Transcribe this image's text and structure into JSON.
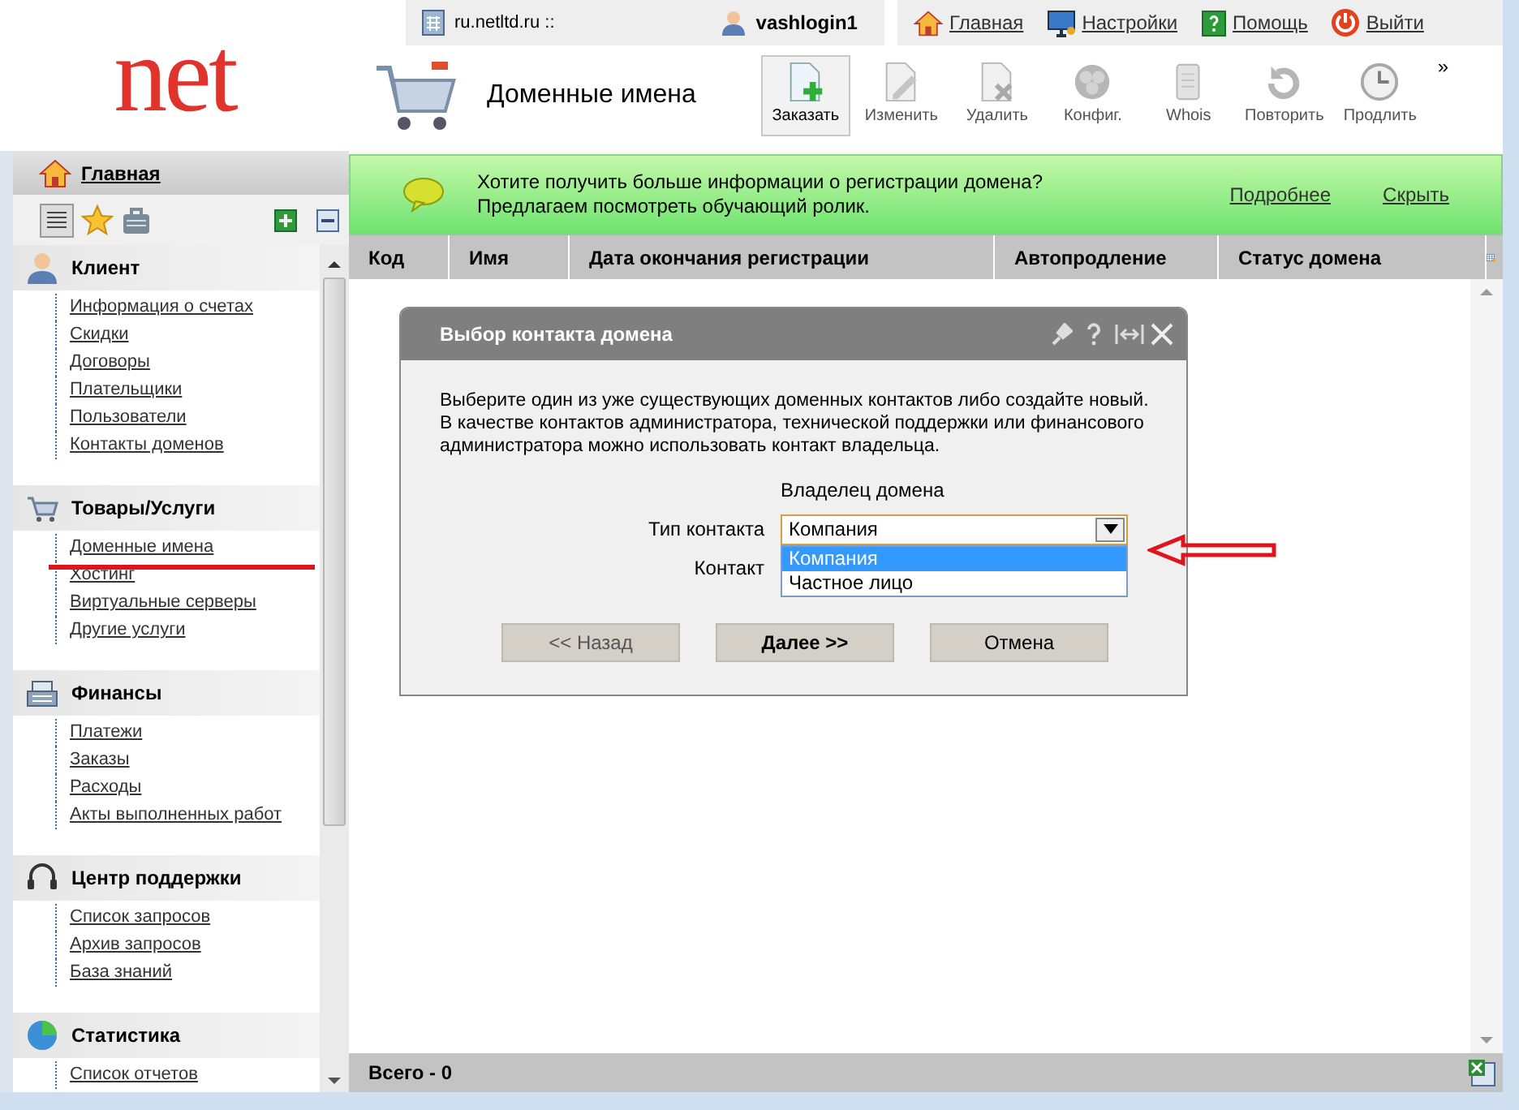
{
  "logo": {
    "text": "net"
  },
  "top_bar": {
    "site": "ru.netltd.ru ::",
    "user": "vashlogin1",
    "links": [
      {
        "label": "Главная"
      },
      {
        "label": "Настройки"
      },
      {
        "label": "Помощь"
      },
      {
        "label": "Выйти"
      }
    ]
  },
  "page_title": "Доменные имена",
  "toolbar": [
    {
      "label": "Заказать",
      "disabled": false
    },
    {
      "label": "Изменить",
      "disabled": true
    },
    {
      "label": "Удалить",
      "disabled": true
    },
    {
      "label": "Конфиг.",
      "disabled": true
    },
    {
      "label": "Whois",
      "disabled": true
    },
    {
      "label": "Повторить",
      "disabled": true
    },
    {
      "label": "Продлить",
      "disabled": true
    }
  ],
  "toolbar_more": "»",
  "sidebar": {
    "home": "Главная",
    "groups": [
      {
        "title": "Клиент",
        "items": [
          "Информация о счетах",
          "Скидки",
          "Договоры",
          "Плательщики",
          "Пользователи",
          "Контакты доменов"
        ]
      },
      {
        "title": "Товары/Услуги",
        "items": [
          "Доменные имена",
          "Хостинг",
          "Виртуальные серверы",
          "Другие услуги"
        ]
      },
      {
        "title": "Финансы",
        "items": [
          "Платежи",
          "Заказы",
          "Расходы",
          "Акты выполненных работ"
        ]
      },
      {
        "title": "Центр поддержки",
        "items": [
          "Список запросов",
          "Архив запросов",
          "База знаний"
        ]
      },
      {
        "title": "Статистика",
        "items": [
          "Список отчетов"
        ]
      }
    ]
  },
  "banner": {
    "text": "Хотите получить больше информации о регистрации домена?\nПредлагаем посмотреть обучающий ролик.",
    "links": [
      "Подробнее",
      "Скрыть"
    ]
  },
  "table": {
    "columns": [
      "Код",
      "Имя",
      "Дата окончания регистрации",
      "Автопродление",
      "Статус домена"
    ],
    "footer": "Всего - 0"
  },
  "dialog": {
    "title": "Выбор контакта домена",
    "intro": "Выберите один из уже существующих доменных контактов либо создайте новый. В качестве контактов администратора, технической поддержки или финансового администратора можно использовать контакт владельца.",
    "section": "Владелец домена",
    "contact_type": {
      "label": "Тип контакта",
      "value": "Компания",
      "expanded": true,
      "options": [
        {
          "label": "Компания",
          "selected": true
        },
        {
          "label": "Частное лицо",
          "selected": false
        }
      ]
    },
    "contact": {
      "label": "Контакт"
    },
    "buttons": [
      {
        "label": "<< Назад",
        "disabled": true,
        "primary": false
      },
      {
        "label": "Далее >>",
        "disabled": false,
        "primary": true
      },
      {
        "label": "Отмена",
        "disabled": false,
        "primary": false
      }
    ]
  }
}
